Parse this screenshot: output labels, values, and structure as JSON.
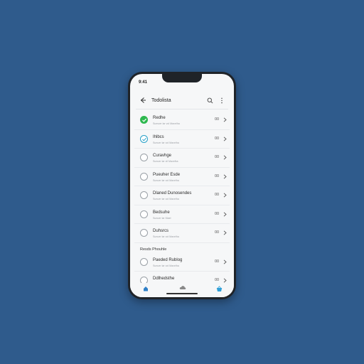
{
  "status_bar": {
    "time": "9:41"
  },
  "header": {
    "title": "Todolista"
  },
  "items_top": [
    {
      "title": "Redhe",
      "subtitle": "Sumuer lar vol Mavelha",
      "count": "00",
      "state": "done"
    },
    {
      "title": "Ihlbcs",
      "subtitle": "Sunuer lar vol Mavelha",
      "count": "00",
      "state": "partial"
    },
    {
      "title": "Curavhge",
      "subtitle": "Sunuer lar vil Mavelha",
      "count": "00",
      "state": "empty"
    },
    {
      "title": "Pueuher Esde",
      "subtitle": "Sunuer lar vol Mavelha",
      "count": "00",
      "state": "empty"
    },
    {
      "title": "Dlaned Dunosendes",
      "subtitle": "Sunuer lar vol Mavelha",
      "count": "00",
      "state": "empty"
    },
    {
      "title": "Bedsuhe",
      "subtitle": "Sunuer lar Mael",
      "count": "00",
      "state": "empty"
    },
    {
      "title": "Duhsrcs",
      "subtitle": "Sunuer lar vol Mavelha",
      "count": "00",
      "state": "empty"
    }
  ],
  "section": {
    "label": "Resds Phouhle"
  },
  "items_bottom": [
    {
      "title": "Paeded Rublog",
      "subtitle": "Sunuer lar vol Mavelha",
      "count": "00",
      "state": "empty"
    },
    {
      "title": "Ddlhedsthe",
      "subtitle": "",
      "count": "00",
      "state": "empty"
    }
  ],
  "colors": {
    "background": "#2f5b8c",
    "done": "#2eb84f",
    "partial": "#28a0c8"
  },
  "icons": [
    "back-arrow-icon",
    "search-icon",
    "more-icon",
    "home-icon",
    "cloud-icon",
    "basket-icon",
    "chevron-right-icon",
    "checkmark-icon"
  ]
}
